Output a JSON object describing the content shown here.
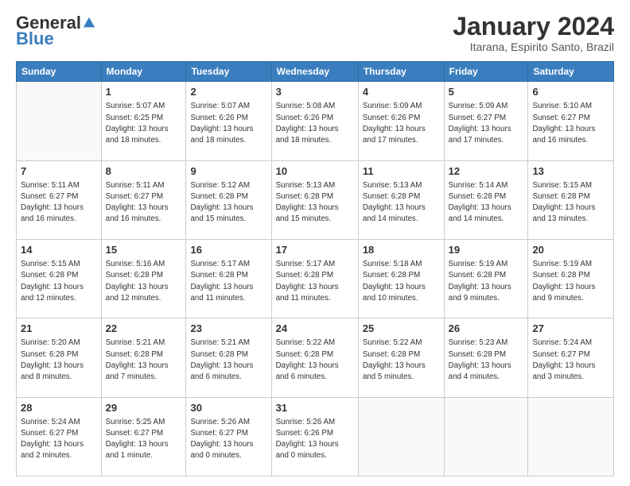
{
  "header": {
    "logo_general": "General",
    "logo_blue": "Blue",
    "month_title": "January 2024",
    "location": "Itarana, Espirito Santo, Brazil"
  },
  "weekdays": [
    "Sunday",
    "Monday",
    "Tuesday",
    "Wednesday",
    "Thursday",
    "Friday",
    "Saturday"
  ],
  "weeks": [
    [
      {
        "day": "",
        "info": ""
      },
      {
        "day": "1",
        "info": "Sunrise: 5:07 AM\nSunset: 6:25 PM\nDaylight: 13 hours\nand 18 minutes."
      },
      {
        "day": "2",
        "info": "Sunrise: 5:07 AM\nSunset: 6:26 PM\nDaylight: 13 hours\nand 18 minutes."
      },
      {
        "day": "3",
        "info": "Sunrise: 5:08 AM\nSunset: 6:26 PM\nDaylight: 13 hours\nand 18 minutes."
      },
      {
        "day": "4",
        "info": "Sunrise: 5:09 AM\nSunset: 6:26 PM\nDaylight: 13 hours\nand 17 minutes."
      },
      {
        "day": "5",
        "info": "Sunrise: 5:09 AM\nSunset: 6:27 PM\nDaylight: 13 hours\nand 17 minutes."
      },
      {
        "day": "6",
        "info": "Sunrise: 5:10 AM\nSunset: 6:27 PM\nDaylight: 13 hours\nand 16 minutes."
      }
    ],
    [
      {
        "day": "7",
        "info": "Sunrise: 5:11 AM\nSunset: 6:27 PM\nDaylight: 13 hours\nand 16 minutes."
      },
      {
        "day": "8",
        "info": "Sunrise: 5:11 AM\nSunset: 6:27 PM\nDaylight: 13 hours\nand 16 minutes."
      },
      {
        "day": "9",
        "info": "Sunrise: 5:12 AM\nSunset: 6:28 PM\nDaylight: 13 hours\nand 15 minutes."
      },
      {
        "day": "10",
        "info": "Sunrise: 5:13 AM\nSunset: 6:28 PM\nDaylight: 13 hours\nand 15 minutes."
      },
      {
        "day": "11",
        "info": "Sunrise: 5:13 AM\nSunset: 6:28 PM\nDaylight: 13 hours\nand 14 minutes."
      },
      {
        "day": "12",
        "info": "Sunrise: 5:14 AM\nSunset: 6:28 PM\nDaylight: 13 hours\nand 14 minutes."
      },
      {
        "day": "13",
        "info": "Sunrise: 5:15 AM\nSunset: 6:28 PM\nDaylight: 13 hours\nand 13 minutes."
      }
    ],
    [
      {
        "day": "14",
        "info": "Sunrise: 5:15 AM\nSunset: 6:28 PM\nDaylight: 13 hours\nand 12 minutes."
      },
      {
        "day": "15",
        "info": "Sunrise: 5:16 AM\nSunset: 6:28 PM\nDaylight: 13 hours\nand 12 minutes."
      },
      {
        "day": "16",
        "info": "Sunrise: 5:17 AM\nSunset: 6:28 PM\nDaylight: 13 hours\nand 11 minutes."
      },
      {
        "day": "17",
        "info": "Sunrise: 5:17 AM\nSunset: 6:28 PM\nDaylight: 13 hours\nand 11 minutes."
      },
      {
        "day": "18",
        "info": "Sunrise: 5:18 AM\nSunset: 6:28 PM\nDaylight: 13 hours\nand 10 minutes."
      },
      {
        "day": "19",
        "info": "Sunrise: 5:19 AM\nSunset: 6:28 PM\nDaylight: 13 hours\nand 9 minutes."
      },
      {
        "day": "20",
        "info": "Sunrise: 5:19 AM\nSunset: 6:28 PM\nDaylight: 13 hours\nand 9 minutes."
      }
    ],
    [
      {
        "day": "21",
        "info": "Sunrise: 5:20 AM\nSunset: 6:28 PM\nDaylight: 13 hours\nand 8 minutes."
      },
      {
        "day": "22",
        "info": "Sunrise: 5:21 AM\nSunset: 6:28 PM\nDaylight: 13 hours\nand 7 minutes."
      },
      {
        "day": "23",
        "info": "Sunrise: 5:21 AM\nSunset: 6:28 PM\nDaylight: 13 hours\nand 6 minutes."
      },
      {
        "day": "24",
        "info": "Sunrise: 5:22 AM\nSunset: 6:28 PM\nDaylight: 13 hours\nand 6 minutes."
      },
      {
        "day": "25",
        "info": "Sunrise: 5:22 AM\nSunset: 6:28 PM\nDaylight: 13 hours\nand 5 minutes."
      },
      {
        "day": "26",
        "info": "Sunrise: 5:23 AM\nSunset: 6:28 PM\nDaylight: 13 hours\nand 4 minutes."
      },
      {
        "day": "27",
        "info": "Sunrise: 5:24 AM\nSunset: 6:27 PM\nDaylight: 13 hours\nand 3 minutes."
      }
    ],
    [
      {
        "day": "28",
        "info": "Sunrise: 5:24 AM\nSunset: 6:27 PM\nDaylight: 13 hours\nand 2 minutes."
      },
      {
        "day": "29",
        "info": "Sunrise: 5:25 AM\nSunset: 6:27 PM\nDaylight: 13 hours\nand 1 minute."
      },
      {
        "day": "30",
        "info": "Sunrise: 5:26 AM\nSunset: 6:27 PM\nDaylight: 13 hours\nand 0 minutes."
      },
      {
        "day": "31",
        "info": "Sunrise: 5:26 AM\nSunset: 6:26 PM\nDaylight: 13 hours\nand 0 minutes."
      },
      {
        "day": "",
        "info": ""
      },
      {
        "day": "",
        "info": ""
      },
      {
        "day": "",
        "info": ""
      }
    ]
  ]
}
